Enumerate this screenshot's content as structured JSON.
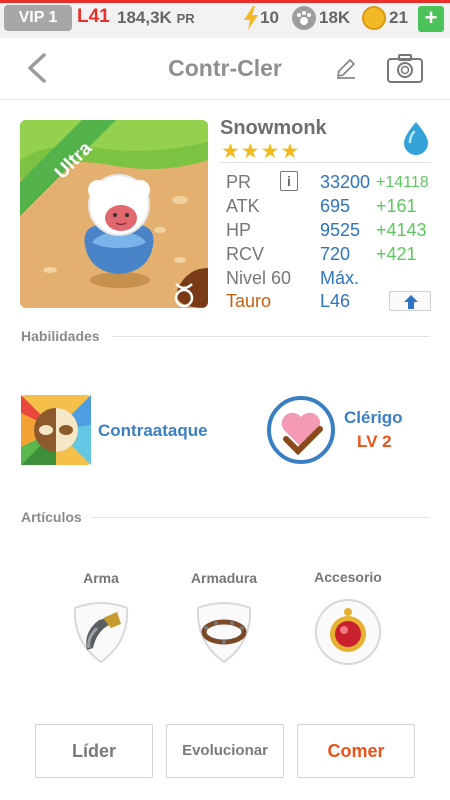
{
  "status_bar": {
    "vip": "VIP 1",
    "level": "L41",
    "pr_value": "184,3K",
    "pr_unit": "PR",
    "energy": "10",
    "paw": "18K",
    "coins": "21",
    "plus": "+"
  },
  "header": {
    "title": "Contr-Cler"
  },
  "monster": {
    "rarity": "Ultra",
    "name": "Snowmonk",
    "stars": "★★★★",
    "stats": [
      {
        "label": "PR",
        "value": "33200",
        "bonus": "+14118"
      },
      {
        "label": "ATK",
        "value": "695",
        "bonus": "+161"
      },
      {
        "label": "HP",
        "value": "9525",
        "bonus": "+4143"
      },
      {
        "label": "RCV",
        "value": "720",
        "bonus": "+421"
      }
    ],
    "level_label": "Nivel 60",
    "level_value": "Máx.",
    "sign_label": "Tauro",
    "sign_value": "L46",
    "info": "i"
  },
  "skills": {
    "section_label": "Habilidades",
    "items": [
      {
        "name": "Contraataque"
      },
      {
        "name": "Clérigo",
        "level": "LV 2"
      }
    ]
  },
  "items": {
    "section_label": "Artículos",
    "slots": [
      {
        "label": "Arma"
      },
      {
        "label": "Armadura"
      },
      {
        "label": "Accesorio"
      }
    ]
  },
  "buttons": {
    "leader": "Líder",
    "evolve": "Evolucionar",
    "eat": "Comer"
  },
  "colors": {
    "accent_red": "#e8302a",
    "stat_blue": "#2f74c0",
    "bonus_green": "#5dc95d",
    "orange": "#e8541a"
  }
}
